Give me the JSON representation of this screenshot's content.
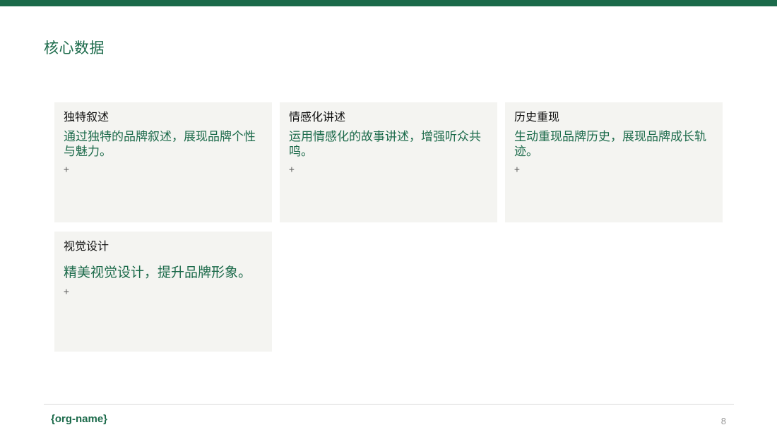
{
  "theme": {
    "accent": "#1b6a4a",
    "card_bg": "#f4f4f1"
  },
  "slide": {
    "title": "核心数据",
    "cards": [
      {
        "title": "独特叙述",
        "description": "通过独特的品牌叙述，展现品牌个性与魅力。",
        "plus": "+"
      },
      {
        "title": "情感化讲述",
        "description": "运用情感化的故事讲述，增强听众共鸣。",
        "plus": "+"
      },
      {
        "title": "历史重现",
        "description": "生动重现品牌历史，展现品牌成长轨迹。",
        "plus": "+"
      },
      {
        "title": "视觉设计",
        "description": "精美视觉设计，提升品牌形象。",
        "plus": "+"
      }
    ],
    "footer": {
      "org_name": "{org-name}",
      "page_number": "8"
    }
  }
}
